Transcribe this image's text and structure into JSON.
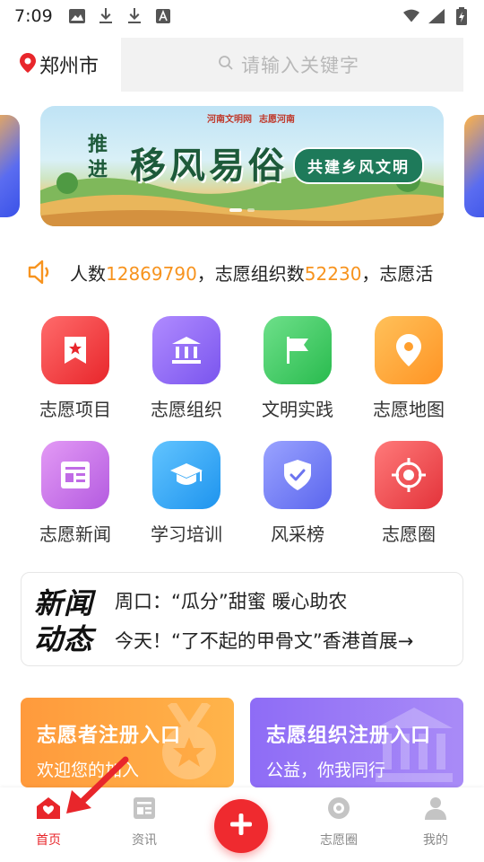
{
  "status_bar": {
    "time": "7:09",
    "icons": [
      "image-icon",
      "download-icon",
      "download-icon",
      "font-icon"
    ],
    "right_icons": [
      "wifi-icon",
      "signal-icon",
      "battery-icon"
    ]
  },
  "header": {
    "city": "郑州市",
    "search_placeholder": "请输入关键字"
  },
  "banner": {
    "side_text": "推进",
    "title": "移风易俗",
    "subtitle": "共建乡风文明",
    "logo_left": "河南文明网",
    "logo_right": "志愿河南"
  },
  "ticker": {
    "prefix": "人数",
    "value1": "12869790",
    "middle": "，志愿组织数",
    "value2": "52230",
    "suffix": "，志愿活"
  },
  "grid": {
    "items": [
      {
        "label": "志愿项目",
        "icon": "bookmark-star-icon",
        "color": "#f0414a"
      },
      {
        "label": "志愿组织",
        "icon": "institution-icon",
        "color": "#8f6cf3"
      },
      {
        "label": "文明实践",
        "icon": "flag-icon",
        "color": "#3fcf63"
      },
      {
        "label": "志愿地图",
        "icon": "map-pin-icon",
        "color": "#ffa83a"
      },
      {
        "label": "志愿新闻",
        "icon": "news-icon",
        "color": "#c76be8"
      },
      {
        "label": "学习培训",
        "icon": "graduation-cap-icon",
        "color": "#34a8f4"
      },
      {
        "label": "风采榜",
        "icon": "shield-check-icon",
        "color": "#6d7bf0"
      },
      {
        "label": "志愿圈",
        "icon": "target-icon",
        "color": "#ef4b4f"
      }
    ]
  },
  "news": {
    "badge": "新闻动态",
    "line1": "周口：“瓜分”甜蜜 暖心助农",
    "line2": "今天！“了不起的甲骨文”香港首展→"
  },
  "cards": {
    "volunteer": {
      "title": "志愿者注册入口",
      "subtitle": "欢迎您的加入"
    },
    "organization": {
      "title": "志愿组织注册入口",
      "subtitle": "公益，你我同行"
    }
  },
  "bottom_nav": {
    "home": "首页",
    "news": "资讯",
    "circle": "志愿圈",
    "mine": "我的"
  },
  "colors": {
    "brand_red": "#ef2a2f",
    "accent_orange": "#f7931e"
  }
}
